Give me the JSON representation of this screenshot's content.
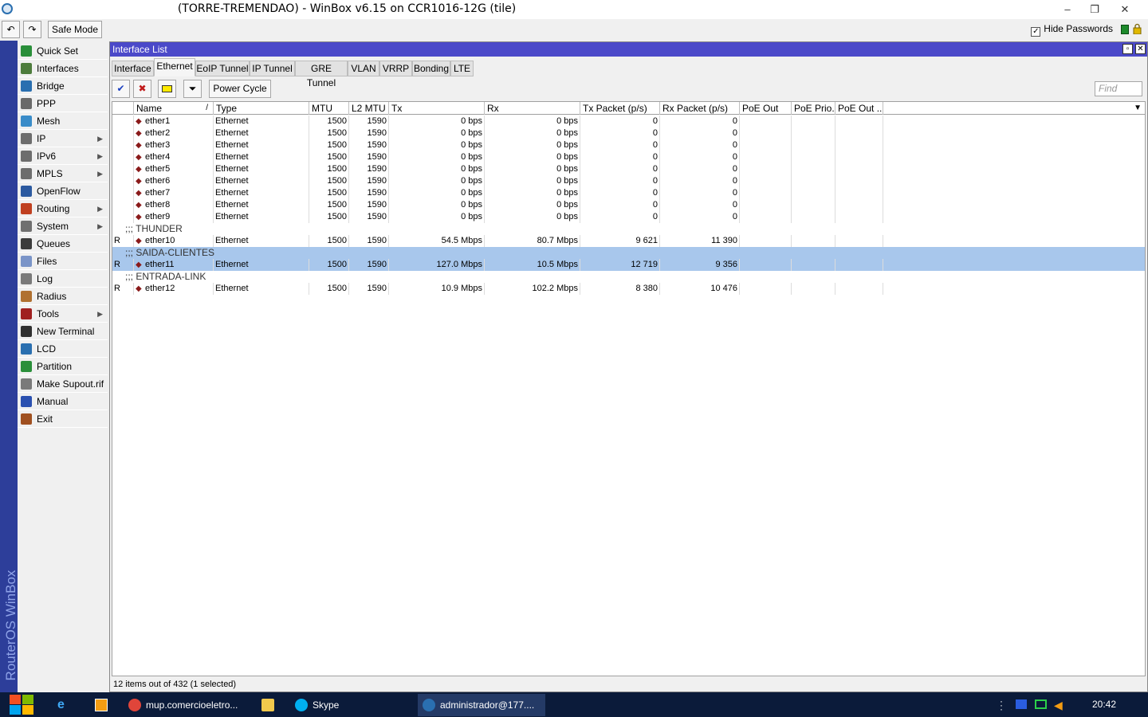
{
  "window": {
    "title": "(TORRE-TREMENDAO) - WinBox v6.15 on CCR1016-12G (tile)",
    "minimize": "–",
    "restore": "❐",
    "close": "✕"
  },
  "toolbar": {
    "undo": "↶",
    "redo": "↷",
    "safe_mode": "Safe Mode",
    "hide_passwords": "Hide Passwords",
    "hide_passwords_checked": true
  },
  "vertical_brand": "RouterOS WinBox",
  "sidebar": {
    "items": [
      {
        "label": "Quick Set",
        "icon": "quick-set-icon",
        "arrow": ""
      },
      {
        "label": "Interfaces",
        "icon": "interfaces-icon",
        "arrow": ""
      },
      {
        "label": "Bridge",
        "icon": "bridge-icon",
        "arrow": ""
      },
      {
        "label": "PPP",
        "icon": "ppp-icon",
        "arrow": ""
      },
      {
        "label": "Mesh",
        "icon": "mesh-icon",
        "arrow": ""
      },
      {
        "label": "IP",
        "icon": "ip-icon",
        "arrow": "▶"
      },
      {
        "label": "IPv6",
        "icon": "ipv6-icon",
        "arrow": "▶"
      },
      {
        "label": "MPLS",
        "icon": "mpls-icon",
        "arrow": "▶"
      },
      {
        "label": "OpenFlow",
        "icon": "openflow-icon",
        "arrow": ""
      },
      {
        "label": "Routing",
        "icon": "routing-icon",
        "arrow": "▶"
      },
      {
        "label": "System",
        "icon": "system-icon",
        "arrow": "▶"
      },
      {
        "label": "Queues",
        "icon": "queues-icon",
        "arrow": ""
      },
      {
        "label": "Files",
        "icon": "files-icon",
        "arrow": ""
      },
      {
        "label": "Log",
        "icon": "log-icon",
        "arrow": ""
      },
      {
        "label": "Radius",
        "icon": "radius-icon",
        "arrow": ""
      },
      {
        "label": "Tools",
        "icon": "tools-icon",
        "arrow": "▶"
      },
      {
        "label": "New Terminal",
        "icon": "terminal-icon",
        "arrow": ""
      },
      {
        "label": "LCD",
        "icon": "lcd-icon",
        "arrow": ""
      },
      {
        "label": "Partition",
        "icon": "partition-icon",
        "arrow": ""
      },
      {
        "label": "Make Supout.rif",
        "icon": "supout-icon",
        "arrow": ""
      },
      {
        "label": "Manual",
        "icon": "manual-icon",
        "arrow": ""
      },
      {
        "label": "Exit",
        "icon": "exit-icon",
        "arrow": ""
      }
    ]
  },
  "interface_window": {
    "title": "Interface List",
    "tabs": [
      "Interface",
      "Ethernet",
      "EoIP Tunnel",
      "IP Tunnel",
      "GRE Tunnel",
      "VLAN",
      "VRRP",
      "Bonding",
      "LTE"
    ],
    "active_tab": "Ethernet",
    "actions": {
      "enable": "✔",
      "disable": "✖",
      "comment": "▭",
      "filter": "⏷",
      "power_cycle": "Power Cycle"
    },
    "find_placeholder": "Find",
    "columns": [
      "",
      "Name",
      "Type",
      "MTU",
      "L2 MTU",
      "Tx",
      "Rx",
      "Tx Packet (p/s)",
      "Rx Packet (p/s)",
      "PoE Out",
      "PoE Prio...",
      "PoE Out ..."
    ],
    "sort_indicator": "/",
    "rows": [
      {
        "kind": "data",
        "flag": "",
        "name": "ether1",
        "type": "Ethernet",
        "mtu": "1500",
        "l2mtu": "1590",
        "tx": "0 bps",
        "rx": "0 bps",
        "txp": "0",
        "rxp": "0",
        "selected": false
      },
      {
        "kind": "data",
        "flag": "",
        "name": "ether2",
        "type": "Ethernet",
        "mtu": "1500",
        "l2mtu": "1590",
        "tx": "0 bps",
        "rx": "0 bps",
        "txp": "0",
        "rxp": "0",
        "selected": false
      },
      {
        "kind": "data",
        "flag": "",
        "name": "ether3",
        "type": "Ethernet",
        "mtu": "1500",
        "l2mtu": "1590",
        "tx": "0 bps",
        "rx": "0 bps",
        "txp": "0",
        "rxp": "0",
        "selected": false
      },
      {
        "kind": "data",
        "flag": "",
        "name": "ether4",
        "type": "Ethernet",
        "mtu": "1500",
        "l2mtu": "1590",
        "tx": "0 bps",
        "rx": "0 bps",
        "txp": "0",
        "rxp": "0",
        "selected": false
      },
      {
        "kind": "data",
        "flag": "",
        "name": "ether5",
        "type": "Ethernet",
        "mtu": "1500",
        "l2mtu": "1590",
        "tx": "0 bps",
        "rx": "0 bps",
        "txp": "0",
        "rxp": "0",
        "selected": false
      },
      {
        "kind": "data",
        "flag": "",
        "name": "ether6",
        "type": "Ethernet",
        "mtu": "1500",
        "l2mtu": "1590",
        "tx": "0 bps",
        "rx": "0 bps",
        "txp": "0",
        "rxp": "0",
        "selected": false
      },
      {
        "kind": "data",
        "flag": "",
        "name": "ether7",
        "type": "Ethernet",
        "mtu": "1500",
        "l2mtu": "1590",
        "tx": "0 bps",
        "rx": "0 bps",
        "txp": "0",
        "rxp": "0",
        "selected": false
      },
      {
        "kind": "data",
        "flag": "",
        "name": "ether8",
        "type": "Ethernet",
        "mtu": "1500",
        "l2mtu": "1590",
        "tx": "0 bps",
        "rx": "0 bps",
        "txp": "0",
        "rxp": "0",
        "selected": false
      },
      {
        "kind": "data",
        "flag": "",
        "name": "ether9",
        "type": "Ethernet",
        "mtu": "1500",
        "l2mtu": "1590",
        "tx": "0 bps",
        "rx": "0 bps",
        "txp": "0",
        "rxp": "0",
        "selected": false
      },
      {
        "kind": "comment",
        "text": ";;; THUNDER",
        "selected": false
      },
      {
        "kind": "data",
        "flag": "R",
        "name": "ether10",
        "type": "Ethernet",
        "mtu": "1500",
        "l2mtu": "1590",
        "tx": "54.5 Mbps",
        "rx": "80.7 Mbps",
        "txp": "9 621",
        "rxp": "11 390",
        "selected": false
      },
      {
        "kind": "comment",
        "text": ";;; SAIDA-CLIENTES",
        "selected": true
      },
      {
        "kind": "data",
        "flag": "R",
        "name": "ether11",
        "type": "Ethernet",
        "mtu": "1500",
        "l2mtu": "1590",
        "tx": "127.0 Mbps",
        "rx": "10.5 Mbps",
        "txp": "12 719",
        "rxp": "9 356",
        "selected": true
      },
      {
        "kind": "comment",
        "text": ";;; ENTRADA-LINK",
        "selected": false
      },
      {
        "kind": "data",
        "flag": "R",
        "name": "ether12",
        "type": "Ethernet",
        "mtu": "1500",
        "l2mtu": "1590",
        "tx": "10.9 Mbps",
        "rx": "102.2 Mbps",
        "txp": "8 380",
        "rxp": "10 476",
        "selected": false
      }
    ],
    "status": "12 items out of 432 (1 selected)"
  },
  "taskbar": {
    "items": [
      {
        "label": "mup.comercioeletro...",
        "icon": "chrome-icon"
      },
      {
        "label": "",
        "icon": "folder-icon"
      },
      {
        "label": "Skype",
        "icon": "skype-icon"
      },
      {
        "label": "administrador@177....",
        "icon": "winbox-icon"
      }
    ],
    "clock": "20:42"
  }
}
